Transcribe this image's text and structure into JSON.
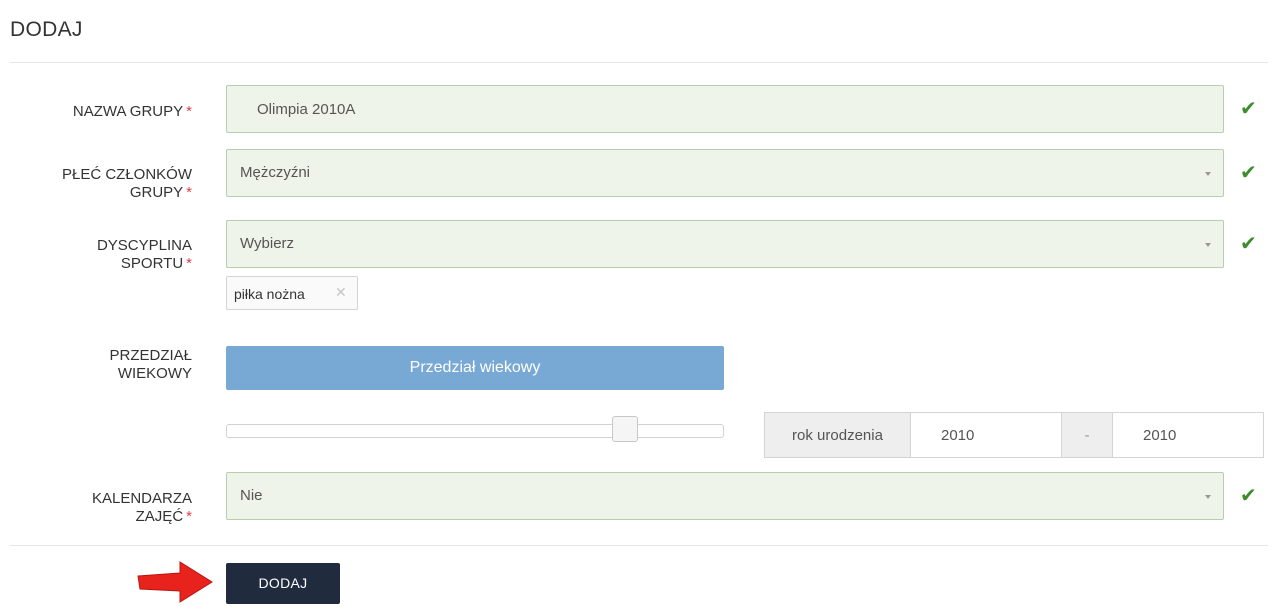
{
  "page": {
    "title": "DODAJ"
  },
  "form": {
    "group_name": {
      "label": "NAZWA GRUPY",
      "required": "*",
      "value": "Olimpia 2010A"
    },
    "gender": {
      "label_line1": "PŁEĆ CZŁONKÓW",
      "label_line2": "GRUPY",
      "required": "*",
      "value": "Mężczyźni"
    },
    "discipline": {
      "label_line1": "DYSCYPLINA",
      "label_line2": "SPORTU",
      "required": "*",
      "value": "Wybierz",
      "selected_tags": [
        "piłka nożna"
      ]
    },
    "age_range": {
      "label_line1": "PRZEDZIAŁ",
      "label_line2": "WIEKOWY",
      "button_label": "Przedział wiekowy",
      "birth_year_label": "rok urodzenia",
      "from": "2010",
      "separator": "-",
      "to": "2010"
    },
    "calendar": {
      "label_line1": "KALENDARZA",
      "label_line2": "ZAJĘĆ",
      "required": "*",
      "value": "Nie"
    },
    "submit_label": "DODAJ"
  },
  "icons": {
    "valid": "check-icon",
    "remove_tag": "close-icon",
    "dropdown": "caret-down-icon",
    "pointer": "red-arrow-icon"
  },
  "colors": {
    "valid_bg": "#eef4ea",
    "valid_border": "#b8cfae",
    "check": "#3c8c2c",
    "required": "#e0404a",
    "range_button": "#78a9d4",
    "submit_bg": "#212b3e",
    "arrow": "#e8231e"
  }
}
